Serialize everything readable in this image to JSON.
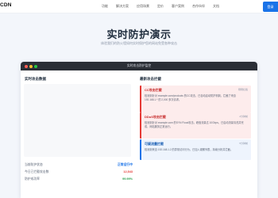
{
  "nav": {
    "logo": "CDN",
    "links": [
      "功能",
      "解决方案",
      "应用场景",
      "定价",
      "客户案例",
      "合作伙伴",
      "文档"
    ],
    "login_label": "登录"
  },
  "hero": {
    "title": "实时防护演示",
    "subtitle": "体验我们的防火墙如何实时保护您的网站免受各种攻击"
  },
  "demo": {
    "window_title": "实时攻击防护监控",
    "left_panel": {
      "title": "实时攻击数据",
      "stats": [
        {
          "label": "当前防护状态",
          "value": "正常运行中",
          "color": "blue"
        },
        {
          "label": "今日已拦截攻击数",
          "value": "12,543",
          "color": "red"
        },
        {
          "label": "防护成功率",
          "value": "99.99%",
          "color": "green"
        }
      ]
    },
    "right_panel": {
      "title": "最新攻击拦截",
      "alerts": [
        {
          "title": "CC攻击拦截",
          "time": "刚刚拦截",
          "body": "检测到针对 example.com/products 的CC攻击，已自动启动防护机制，拦截了来自 192.168.1.* 的 2,000 多次请求。"
        },
        {
          "title": "DDoS攻击拦截",
          "time": "2分钟前",
          "body": "检测到针对 example.com 的SYN Flood攻击，峰值流量达 10Gbps，已启动流量清洗并完成，网站服务正常运行。"
        },
        {
          "title": "可疑流量拦截",
          "time": "5分钟前",
          "body": "检测到来自 192.168.1.2 的异常访问行为，已加入观察列表，持续分析并拦截。"
        }
      ]
    }
  },
  "colors": {
    "accent": "#1a73e8",
    "danger": "#e53935",
    "success": "#2e9e4f",
    "window_bar": "#2b2f36"
  }
}
